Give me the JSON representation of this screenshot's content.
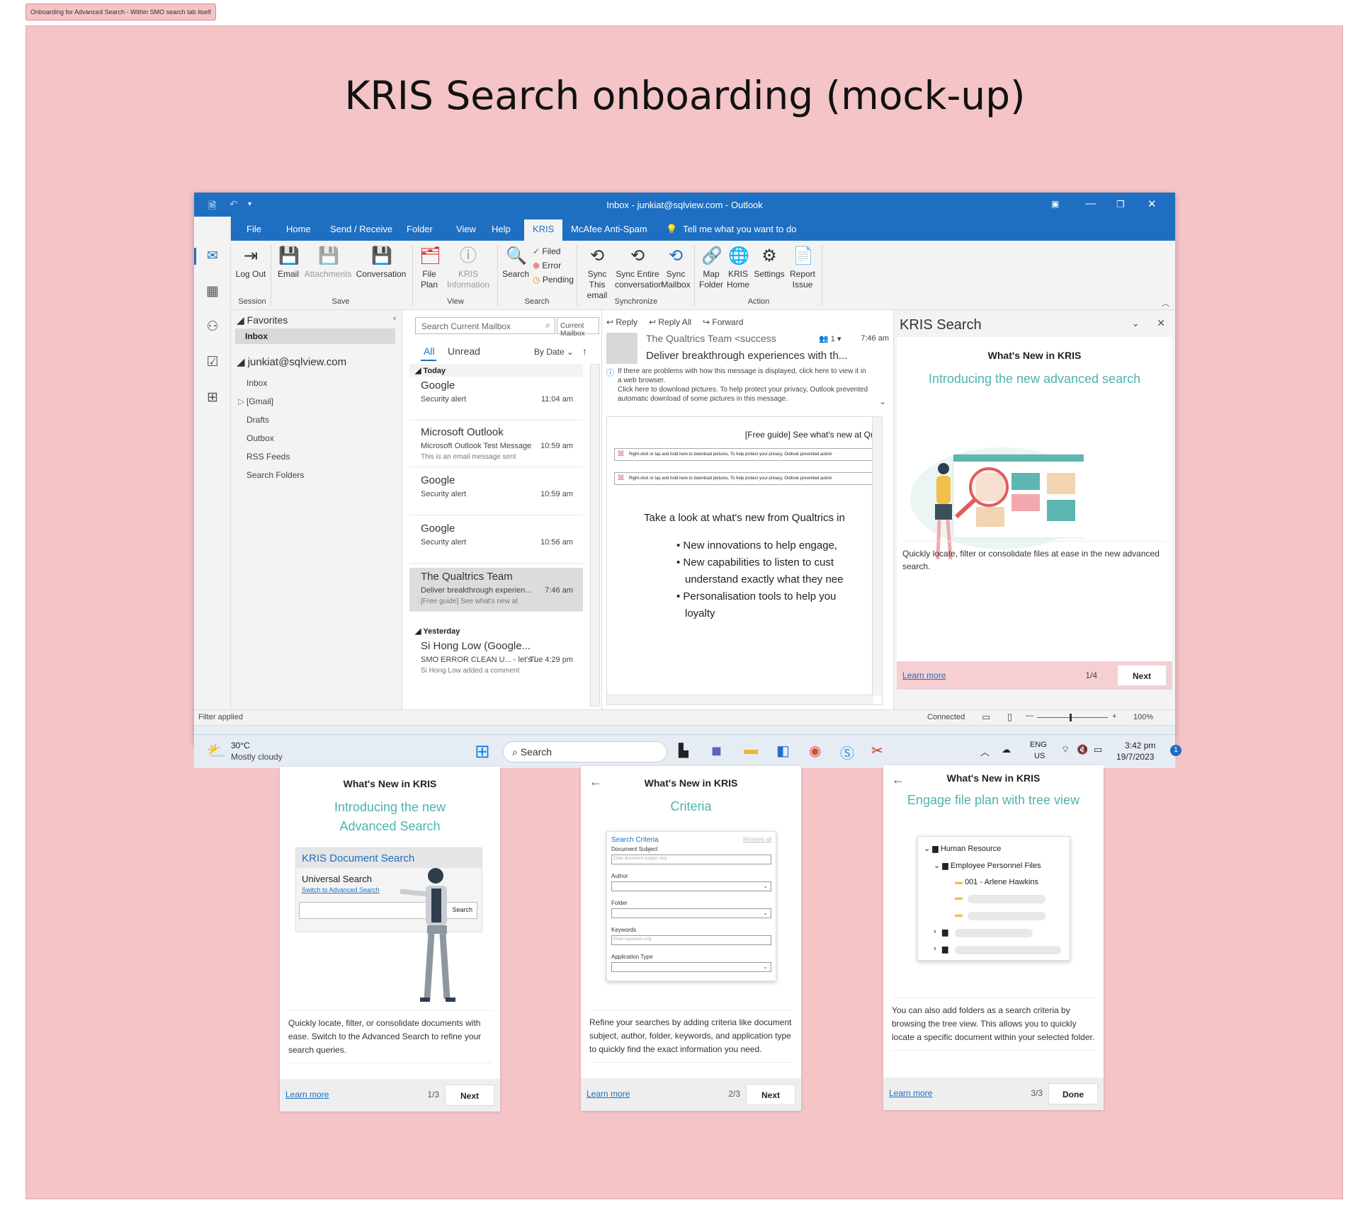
{
  "note_tag": "Onboarding for Advanced Search - Within SMO search tab itself",
  "page_title": "KRIS Search onboarding (mock-up)",
  "outlook": {
    "window_title": "Inbox - junkiat@sqlview.com  -  Outlook",
    "tabs": [
      "File",
      "Home",
      "Send / Receive",
      "Folder",
      "View",
      "Help",
      "KRIS",
      "McAfee Anti-Spam"
    ],
    "tell_me": "Tell me what you want to do",
    "ribbon": {
      "logout": "Log Out",
      "session": "Session",
      "email": "Email",
      "attachments": "Attachments",
      "conversation": "Conversation",
      "save": "Save",
      "file_plan": "File Plan",
      "kris_info": "KRIS Information",
      "view": "View",
      "search": "Search",
      "filed": "Filed",
      "error": "Error",
      "pending": "Pending",
      "search_grp": "Search",
      "sync_email": "Sync This email",
      "sync_conv": "Sync Entire conversation",
      "sync_mailbox": "Sync Mailbox",
      "synchronize": "Synchronize",
      "map_folder": "Map Folder",
      "kris_home": "KRIS Home",
      "settings": "Settings",
      "report_issue": "Report Issue",
      "action": "Action"
    },
    "folders": {
      "favorites": "Favorites",
      "inbox_fav": "Inbox",
      "account": "junkiat@sqlview.com",
      "items": [
        "Inbox",
        "[Gmail]",
        "Drafts",
        "Outbox",
        "RSS Feeds",
        "Search Folders"
      ]
    },
    "list": {
      "search_placeholder": "Search Current Mailbox",
      "scope": "Current Mailbox",
      "all": "All",
      "unread": "Unread",
      "sort": "By Date",
      "today": "Today",
      "yesterday": "Yesterday",
      "messages": [
        {
          "from": "Google",
          "subject": "Security alert",
          "preview": "",
          "time": "11:04 am"
        },
        {
          "from": "Microsoft Outlook",
          "subject": "Microsoft Outlook Test Message",
          "preview": "This is an email message sent",
          "time": "10:59 am"
        },
        {
          "from": "Google",
          "subject": "Security alert",
          "preview": "",
          "time": "10:59 am"
        },
        {
          "from": "Google",
          "subject": "Security alert",
          "preview": "",
          "time": "10:56 am"
        },
        {
          "from": "The Qualtrics Team",
          "subject": "Deliver breakthrough experien...",
          "preview": "[Free guide] See what's new at",
          "time": "7:46 am"
        },
        {
          "from": "Si Hong Low (Google...",
          "subject": "SMO ERROR CLEAN U... - let's l...",
          "preview": "Si Hong Low added a comment",
          "time": "Tue 4:29 pm"
        }
      ]
    },
    "reading": {
      "reply": "Reply",
      "reply_all": "Reply All",
      "forward": "Forward",
      "sender": "The Qualtrics Team <success",
      "count": "1",
      "time": "7:46 am",
      "subject": "Deliver breakthrough experiences with th...",
      "info1": "If there are problems with how this message is displayed, click here to view it in a web browser.",
      "info2": "Click here to download pictures. To help protect your privacy, Outlook prevented automatic download of some pictures in this message.",
      "body_top": "[Free guide] See what's new at Qual",
      "img_note": "Right-click or tap and hold here to download pictures. To help protect your privacy, Outlook prevented autom",
      "body_head": "Take a look at what's new from Qualtrics in",
      "bullets": [
        "New innovations to help engage,",
        "New capabilities to listen to cust",
        "understand exactly what they nee",
        "Personalisation tools to help you",
        "loyalty"
      ]
    },
    "kris_pane": {
      "title": "KRIS Search",
      "heading": "What's New in KRIS",
      "subtitle": "Introducing the new advanced search",
      "desc": "Quickly locate, filter or consolidate files at ease in the new advanced search.",
      "learn": "Learn more",
      "page": "1/4",
      "next": "Next"
    },
    "status": {
      "left": "Filter applied",
      "connected": "Connected",
      "zoom": "100%"
    },
    "taskbar": {
      "temp": "30°C",
      "weather": "Mostly cloudy",
      "search": "Search",
      "lang1": "ENG",
      "lang2": "US",
      "time": "3:42 pm",
      "date": "19/7/2023",
      "notif": "1"
    }
  },
  "cards": [
    {
      "heading": "What's New in KRIS",
      "subtitle": "Introducing the new Advanced Search",
      "panel_title": "KRIS Document Search",
      "panel_universal": "Universal Search",
      "panel_switch": "Switch to Advanced Search",
      "panel_btn": "Search",
      "desc": "Quickly locate, filter, or consolidate documents with ease. Switch to the Advanced Search to refine your search queries.",
      "learn": "Learn more",
      "page": "1/3",
      "button": "Next"
    },
    {
      "heading": "What's New in KRIS",
      "subtitle": "Criteria",
      "form_title": "Search Criteria",
      "remove_all": "Remove all",
      "labels": [
        "Document Subject",
        "Author",
        "Folder",
        "Keywords",
        "Application Type"
      ],
      "placeholders": [
        "Enter document subject only",
        "",
        "",
        "Enter keywords only",
        ""
      ],
      "desc": "Refine your searches by adding criteria like document subject, author, folder, keywords, and application type to quickly find the exact information you need.",
      "learn": "Learn more",
      "page": "2/3",
      "button": "Next"
    },
    {
      "heading": "What's New in KRIS",
      "subtitle": "Engage file plan with tree view",
      "tree": [
        "Human Resource",
        "Employee Personnel Files",
        "001 - Arlene Hawkins"
      ],
      "desc": "You can also add folders as a search criteria by browsing the tree view. This allows you to quickly locate a specific document within your selected folder.",
      "learn": "Learn more",
      "page": "3/3",
      "button": "Done"
    }
  ],
  "colors": {
    "board": "#f4c4c7",
    "outlook_blue": "#1e6fc2",
    "teal": "#4db3b0"
  }
}
